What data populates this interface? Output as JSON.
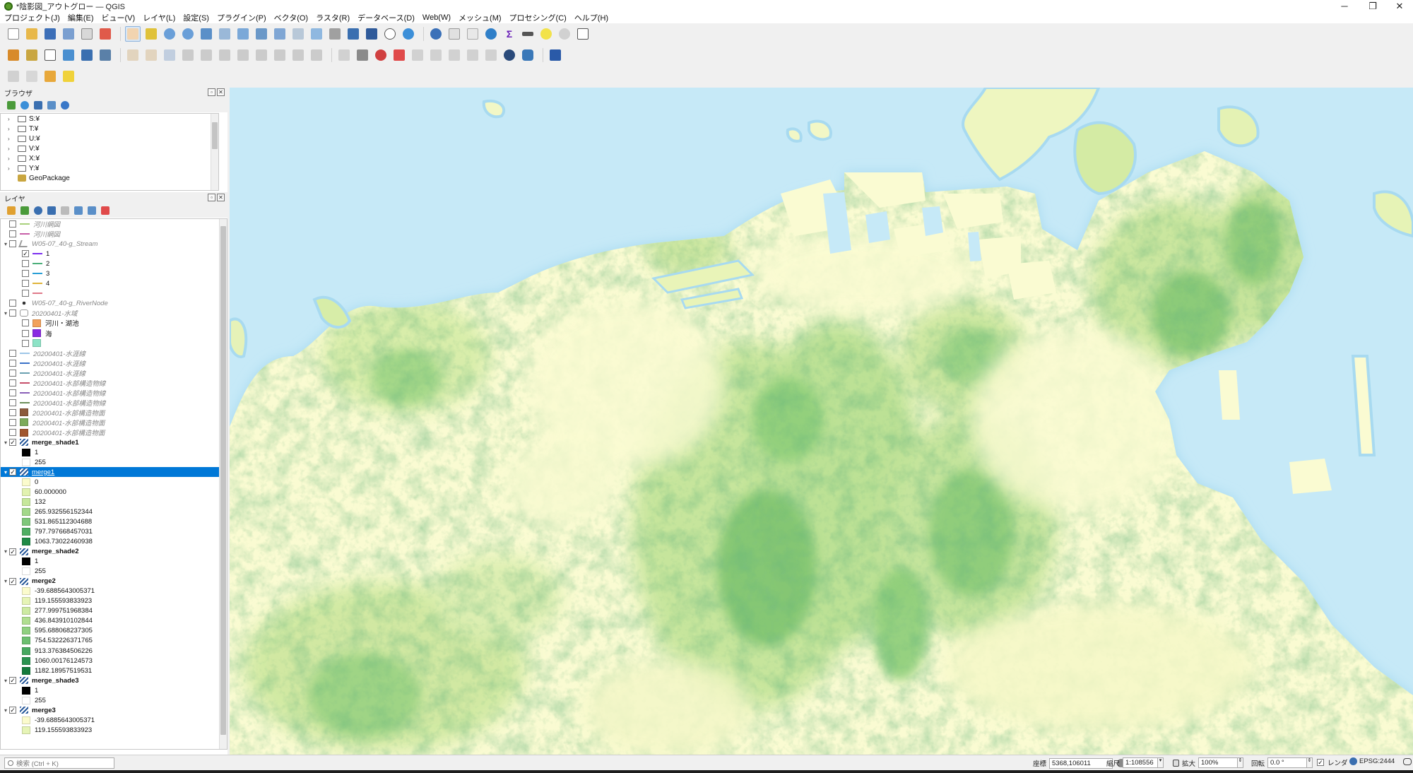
{
  "window": {
    "title": "*陰影図_アウトグロー — QGIS",
    "controls": [
      "─",
      "❐",
      "✕"
    ]
  },
  "menu": [
    "プロジェクト(J)",
    "編集(E)",
    "ビュー(V)",
    "レイヤ(L)",
    "設定(S)",
    "プラグイン(P)",
    "ベクタ(O)",
    "ラスタ(R)",
    "データベース(D)",
    "Web(W)",
    "メッシュ(M)",
    "プロセシング(C)",
    "ヘルプ(H)"
  ],
  "browser": {
    "title": "ブラウザ",
    "items": [
      {
        "label": "S:¥",
        "kind": "folder"
      },
      {
        "label": "T:¥",
        "kind": "folder"
      },
      {
        "label": "U:¥",
        "kind": "folder"
      },
      {
        "label": "V:¥",
        "kind": "folder"
      },
      {
        "label": "X:¥",
        "kind": "folder"
      },
      {
        "label": "Y:¥",
        "kind": "folder"
      },
      {
        "label": "GeoPackage",
        "kind": "geopackage"
      }
    ]
  },
  "layers": {
    "title": "レイヤ",
    "rows": [
      {
        "label": "河川網図",
        "indent": 1,
        "cb": false,
        "kind": "line",
        "color": "#a9d17c",
        "style": "it"
      },
      {
        "label": "河川網図",
        "indent": 1,
        "cb": false,
        "kind": "line",
        "color": "#c85fa8",
        "style": "it"
      },
      {
        "label": "W05-07_40-g_Stream",
        "indent": 0,
        "cb": false,
        "kind": "vline",
        "tw": "▾",
        "style": "it"
      },
      {
        "label": "1",
        "indent": 2,
        "cb": true,
        "kind": "line",
        "color": "#7b2ff0"
      },
      {
        "label": "2",
        "indent": 2,
        "cb": false,
        "kind": "line",
        "color": "#4caf7a"
      },
      {
        "label": "3",
        "indent": 2,
        "cb": false,
        "kind": "line",
        "color": "#2a9fd6"
      },
      {
        "label": "4",
        "indent": 2,
        "cb": false,
        "kind": "line",
        "color": "#e0b43a"
      },
      {
        "label": "",
        "indent": 2,
        "cb": false,
        "kind": "line",
        "color": "#e07a8a"
      },
      {
        "label": "W05-07_40-g_RiverNode",
        "indent": 1,
        "cb": false,
        "kind": "dot",
        "style": "it"
      },
      {
        "label": "20200401-水域",
        "indent": 0,
        "cb": false,
        "kind": "poly",
        "tw": "▾",
        "style": "it"
      },
      {
        "label": "河川・湖池",
        "indent": 2,
        "cb": false,
        "kind": "swatch",
        "color": "#f2a15a"
      },
      {
        "label": "海",
        "indent": 2,
        "cb": false,
        "kind": "swatch",
        "color": "#8a2be2"
      },
      {
        "label": "",
        "indent": 2,
        "cb": false,
        "kind": "swatch",
        "color": "#8de3c6"
      },
      {
        "label": "20200401-水涯線",
        "indent": 1,
        "cb": false,
        "kind": "line",
        "color": "#9ec6e8",
        "style": "it"
      },
      {
        "label": "20200401-水涯線",
        "indent": 1,
        "cb": false,
        "kind": "line",
        "color": "#3a72c8",
        "style": "it"
      },
      {
        "label": "20200401-水涯線",
        "indent": 1,
        "cb": false,
        "kind": "line",
        "color": "#6aa0b0",
        "style": "it"
      },
      {
        "label": "20200401-水部構造物線",
        "indent": 1,
        "cb": false,
        "kind": "line",
        "color": "#c64f6a",
        "style": "it"
      },
      {
        "label": "20200401-水部構造物線",
        "indent": 1,
        "cb": false,
        "kind": "line",
        "color": "#8a5fb8",
        "style": "it"
      },
      {
        "label": "20200401-水部構造物線",
        "indent": 1,
        "cb": false,
        "kind": "line",
        "color": "#6c8f5a",
        "style": "it"
      },
      {
        "label": "20200401-水部構造物面",
        "indent": 1,
        "cb": false,
        "kind": "swatch",
        "color": "#8c5a3c",
        "style": "it"
      },
      {
        "label": "20200401-水部構造物面",
        "indent": 1,
        "cb": false,
        "kind": "swatch",
        "color": "#7cab5a",
        "style": "it"
      },
      {
        "label": "20200401-水部構造物面",
        "indent": 1,
        "cb": false,
        "kind": "swatch",
        "color": "#a0562e",
        "style": "it"
      },
      {
        "label": "merge_shade1",
        "indent": 0,
        "cb": true,
        "kind": "raster",
        "tw": "▾",
        "style": "b"
      },
      {
        "label": "1",
        "indent": 2,
        "kind": "swatch",
        "color": "#000000"
      },
      {
        "label": "255",
        "indent": 2,
        "kind": "swatch",
        "color": "#ffffff"
      },
      {
        "label": "merge1",
        "indent": 0,
        "cb": true,
        "kind": "raster",
        "tw": "▾",
        "style": "u",
        "selected": true
      },
      {
        "label": "0",
        "indent": 2,
        "kind": "swatch",
        "color": "#fbfbcd"
      },
      {
        "label": "60.000000",
        "indent": 2,
        "kind": "swatch",
        "color": "#e2f2b0"
      },
      {
        "label": "132",
        "indent": 2,
        "kind": "swatch",
        "color": "#c6e79b"
      },
      {
        "label": "265.932556152344",
        "indent": 2,
        "kind": "swatch",
        "color": "#a3d88a"
      },
      {
        "label": "531.865112304688",
        "indent": 2,
        "kind": "swatch",
        "color": "#7ec77a"
      },
      {
        "label": "797.797668457031",
        "indent": 2,
        "kind": "swatch",
        "color": "#4fae63"
      },
      {
        "label": "1063.73022460938",
        "indent": 2,
        "kind": "swatch",
        "color": "#1f8a46"
      },
      {
        "label": "merge_shade2",
        "indent": 0,
        "cb": true,
        "kind": "raster",
        "tw": "▾",
        "style": "b"
      },
      {
        "label": "1",
        "indent": 2,
        "kind": "swatch",
        "color": "#000000"
      },
      {
        "label": "255",
        "indent": 2,
        "kind": "swatch",
        "color": "#ffffff"
      },
      {
        "label": "merge2",
        "indent": 0,
        "cb": true,
        "kind": "raster",
        "tw": "▾",
        "style": "b"
      },
      {
        "label": "-39.6885643005371",
        "indent": 2,
        "kind": "swatch",
        "color": "#fbfbcd"
      },
      {
        "label": "119.155593833923",
        "indent": 2,
        "kind": "swatch",
        "color": "#e6f4b6"
      },
      {
        "label": "277.999751968384",
        "indent": 2,
        "kind": "swatch",
        "color": "#cdeaa2"
      },
      {
        "label": "436.843910102844",
        "indent": 2,
        "kind": "swatch",
        "color": "#b0de90"
      },
      {
        "label": "595.688068237305",
        "indent": 2,
        "kind": "swatch",
        "color": "#8fd080"
      },
      {
        "label": "754.532226371765",
        "indent": 2,
        "kind": "swatch",
        "color": "#6cbf70"
      },
      {
        "label": "913.376384506226",
        "indent": 2,
        "kind": "swatch",
        "color": "#47a860"
      },
      {
        "label": "1060.00176124573",
        "indent": 2,
        "kind": "swatch",
        "color": "#2a924f"
      },
      {
        "label": "1182.18957519531",
        "indent": 2,
        "kind": "swatch",
        "color": "#147a3c"
      },
      {
        "label": "merge_shade3",
        "indent": 0,
        "cb": true,
        "kind": "raster",
        "tw": "▾",
        "style": "b"
      },
      {
        "label": "1",
        "indent": 2,
        "kind": "swatch",
        "color": "#000000"
      },
      {
        "label": "255",
        "indent": 2,
        "kind": "swatch",
        "color": "#ffffff"
      },
      {
        "label": "merge3",
        "indent": 0,
        "cb": true,
        "kind": "raster",
        "tw": "▾",
        "style": "b"
      },
      {
        "label": "-39.6885643005371",
        "indent": 2,
        "kind": "swatch",
        "color": "#fbfbcd"
      },
      {
        "label": "119.155593833923",
        "indent": 2,
        "kind": "swatch",
        "color": "#e6f4b6"
      }
    ]
  },
  "status": {
    "search_placeholder": "検索 (Ctrl + K)",
    "coord_label": "座標",
    "coord_value": "5368,106011",
    "scale_label": "縮尺",
    "scale_value": "1:108556",
    "magnify_label": "拡大",
    "magnify_value": "100%",
    "rotation_label": "回転",
    "rotation_value": "0.0 °",
    "render_label": "レンダ",
    "crs_label": "EPSG:2444"
  },
  "colors": {
    "sea": "#c6e9f7",
    "lowland": "#fafbd2",
    "hill": "#c2e59a",
    "mountain": "#4fae63",
    "selection": "#0078d7"
  }
}
